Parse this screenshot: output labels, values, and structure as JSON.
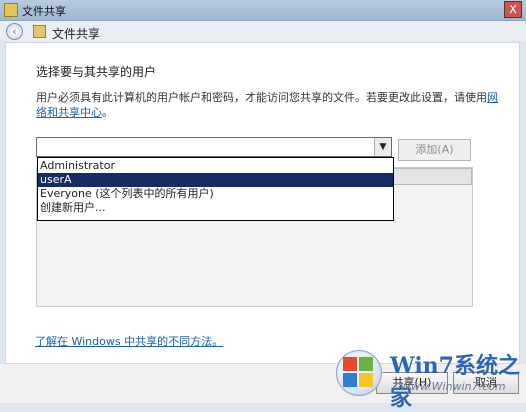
{
  "window": {
    "title": "文件共享",
    "close_glyph": "X"
  },
  "nav": {
    "title": "文件共享",
    "back_glyph": "‹"
  },
  "main": {
    "heading": "选择要与其共享的用户",
    "instructions_text": "用户必须具有此计算机的用户帐户和密码，才能访问您共享的文件。若要更改此设置，请使用",
    "instructions_link": "网络和共享中心",
    "instructions_end": "。",
    "combo_value": "",
    "combo_arrow": "▼",
    "add_button": "添加(A)",
    "dropdown_items": [
      {
        "label": "Administrator",
        "selected": false
      },
      {
        "label": "userA",
        "selected": true
      },
      {
        "label": "Everyone (这个列表中的所有用户)",
        "selected": false
      },
      {
        "label": "创建新用户...",
        "selected": false
      }
    ],
    "help_link": "了解在 Windows 中共享的不同方法。"
  },
  "footer": {
    "share_button": "共享(H)",
    "cancel_button": "取消"
  },
  "watermark": {
    "logo_text": "Win7系统之家",
    "site": "Www.Winwin7.com"
  },
  "colors": {
    "selected_row": "#152c64",
    "link": "#1b5fb1"
  }
}
